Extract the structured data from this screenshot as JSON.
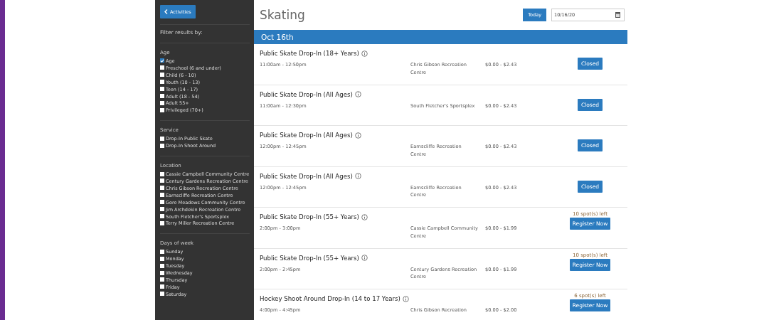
{
  "sidebar": {
    "back_button": "Activities",
    "filter_heading": "Filter results by:",
    "groups": [
      {
        "title": "Age",
        "options": [
          {
            "label": "Age",
            "checked": true
          },
          {
            "label": "Preschool (6 and under)",
            "checked": false
          },
          {
            "label": "Child (6 - 10)",
            "checked": false
          },
          {
            "label": "Youth (10 - 13)",
            "checked": false
          },
          {
            "label": "Teen (14 - 17)",
            "checked": false
          },
          {
            "label": "Adult (18 - 54)",
            "checked": false
          },
          {
            "label": "Adult 55+",
            "checked": false
          },
          {
            "label": "Privileged (70+)",
            "checked": false
          }
        ]
      },
      {
        "title": "Service",
        "options": [
          {
            "label": "Drop-In Public Skate",
            "checked": false
          },
          {
            "label": "Drop-In Shoot Around",
            "checked": false
          }
        ]
      },
      {
        "title": "Location",
        "options": [
          {
            "label": "Cassie Campbell Community Centre",
            "checked": false
          },
          {
            "label": "Century Gardens Recreation Centre",
            "checked": false
          },
          {
            "label": "Chris Gibson Recreation Centre",
            "checked": false
          },
          {
            "label": "Earnscliffe Recreation Centre",
            "checked": false
          },
          {
            "label": "Gore Meadows Community Centre",
            "checked": false
          },
          {
            "label": "Jim Archdekin Recreation Centre",
            "checked": false
          },
          {
            "label": "South Fletcher's Sportsplex",
            "checked": false
          },
          {
            "label": "Terry Miller Recreation Centre",
            "checked": false
          }
        ]
      },
      {
        "title": "Days of week",
        "options": [
          {
            "label": "Sunday",
            "checked": false
          },
          {
            "label": "Monday",
            "checked": false
          },
          {
            "label": "Tuesday",
            "checked": false
          },
          {
            "label": "Wednesday",
            "checked": false
          },
          {
            "label": "Thursday",
            "checked": false
          },
          {
            "label": "Friday",
            "checked": false
          },
          {
            "label": "Saturday",
            "checked": false
          }
        ]
      }
    ]
  },
  "main": {
    "title": "Skating",
    "today_button": "Today",
    "date_field": "10/16/20",
    "date_heading": "Oct 16th",
    "sessions": [
      {
        "name": "Public Skate Drop-In (18+ Years)",
        "time": "11:00am - 12:50pm",
        "location": "Chris Gibson Recreation Centre",
        "price": "$0.00 - $2.43",
        "button": "Closed",
        "kind": "closed"
      },
      {
        "name": "Public Skate Drop-In (All Ages)",
        "time": "11:00am - 12:30pm",
        "location": "South Fletcher's Sportsplex",
        "price": "$0.00 - $2.43",
        "button": "Closed",
        "kind": "closed"
      },
      {
        "name": "Public Skate Drop-In (All Ages)",
        "time": "12:00pm - 12:45pm",
        "location": "Earnscliffe Recreation Centre",
        "price": "$0.00 - $2.43",
        "button": "Closed",
        "kind": "closed"
      },
      {
        "name": "Public Skate Drop-In (All Ages)",
        "time": "12:00pm - 12:45pm",
        "location": "Earnscliffe Recreation Centre",
        "price": "$0.00 - $2.43",
        "button": "Closed",
        "kind": "closed"
      },
      {
        "name": "Public Skate Drop-In (55+ Years)",
        "time": "2:00pm - 3:00pm",
        "location": "Cassie Campbell Community Centre",
        "price": "$0.00 - $1.99",
        "button": "Register Now",
        "kind": "register",
        "spots": "10 spot(s) left"
      },
      {
        "name": "Public Skate Drop-In (55+ Years)",
        "time": "2:00pm - 2:45pm",
        "location": "Century Gardens Recreation Centre",
        "price": "$0.00 - $1.99",
        "button": "Register Now",
        "kind": "register",
        "spots": "10 spot(s) left"
      },
      {
        "name": "Hockey Shoot Around Drop-In (14 to 17 Years)",
        "time": "4:00pm - 4:45pm",
        "location": "Chris Gibson Recreation",
        "price": "$0.00 - $2.00",
        "button": "Register Now",
        "kind": "register",
        "spots": "6 spot(s) left"
      }
    ]
  }
}
